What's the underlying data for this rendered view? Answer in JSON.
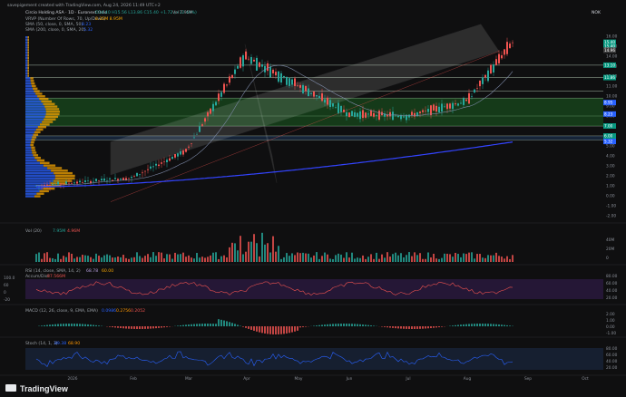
{
  "window": {
    "credit": "savepigement created with TradingView.com, Aug 24, 2026 11:49 UTC+2",
    "currency": "NOK"
  },
  "legend": {
    "symbol": "Circio Holding ASA · 1D · Euronext Oslo",
    "ohlc": "O14.40 H15.56 L13.86 C15.40 +1.72 (+12.49%)",
    "volume": "Vol 7.95M",
    "vrvp": "VRVP (Number Of Rows, 70, Up/Down)",
    "vrvp_vals": "8.35M  8.95M",
    "sma50": "SMA (50, close, 0, SMA, 50)",
    "sma50_val": "8.23",
    "sma200": "SMA (200, close, 0, SMA, 20)",
    "sma200_val": "5.32"
  },
  "price_axis": [
    {
      "label": "16.00",
      "v": 16.0
    },
    {
      "label": "15.00",
      "v": 15.0
    },
    {
      "label": "14.00",
      "v": 14.0
    },
    {
      "label": "13.00",
      "v": 13.0
    },
    {
      "label": "12.00",
      "v": 12.0
    },
    {
      "label": "11.00",
      "v": 11.0
    },
    {
      "label": "10.00",
      "v": 10.0
    },
    {
      "label": "9.00",
      "v": 9.0
    },
    {
      "label": "8.00",
      "v": 8.0
    },
    {
      "label": "7.00",
      "v": 7.0
    },
    {
      "label": "6.00",
      "v": 6.0
    },
    {
      "label": "5.00",
      "v": 5.0
    },
    {
      "label": "4.00",
      "v": 4.0
    },
    {
      "label": "3.00",
      "v": 3.0
    },
    {
      "label": "2.00",
      "v": 2.0
    },
    {
      "label": "1.00",
      "v": 1.0
    },
    {
      "label": "0.00",
      "v": 0.0
    },
    {
      "label": "-1.00",
      "v": -1.0
    },
    {
      "label": "-2.00",
      "v": -2.0
    }
  ],
  "price_tags": [
    {
      "label": "15.40",
      "v": 15.4,
      "color": "#089981"
    },
    {
      "label": "15.40",
      "v": 15.0,
      "color": "#089981"
    },
    {
      "label": "14.96",
      "v": 14.6,
      "color": "#3d3d3d"
    },
    {
      "label": "8.95",
      "v": 9.35,
      "color": "#2962ff"
    },
    {
      "label": "8.23",
      "v": 8.2,
      "color": "#2962ff"
    },
    {
      "label": "5.32",
      "v": 5.45,
      "color": "#2962ff"
    },
    {
      "label": "13.10",
      "v": 13.1,
      "color": "#089981"
    },
    {
      "label": "11.86",
      "v": 11.86,
      "color": "#089981"
    },
    {
      "label": "6.00",
      "v": 6.0,
      "color": "#089981"
    },
    {
      "label": "7.00",
      "v": 7.0,
      "color": "#089981"
    }
  ],
  "horizontal_levels": [
    13.1,
    11.86,
    10.5,
    9.8,
    8.0,
    7.0,
    6.0,
    5.6
  ],
  "time_axis": [
    "2026",
    "Feb",
    "Mar",
    "Apr",
    "May",
    "Jun",
    "Jul",
    "Aug",
    "Sep",
    "Oct"
  ],
  "panes": {
    "volume": {
      "title": "Vol (20)",
      "v1": "7.95M",
      "v2": "4.96M",
      "axis": [
        "40M",
        "20M",
        "0"
      ]
    },
    "rsi": {
      "title": "RSI (14, close, SMA, 14, 2)",
      "v1": "68.78",
      "v2": "60.00",
      "axis": [
        "80.00",
        "60.00",
        "40.00",
        "20.00"
      ],
      "sub": "Accum/Dist",
      "sub_val": "87.566M",
      "left": [
        "100.0",
        "60",
        "0",
        "-20"
      ]
    },
    "macd": {
      "title": "MACD (12, 26, close, 9, EMA, EMA)",
      "v1": "0.0986",
      "v2": "0.2756",
      "v3": "0.2052",
      "axis": [
        "2.00",
        "1.00",
        "0.00",
        "-1.00"
      ]
    },
    "stoch": {
      "title": "Stoch (14, 1, 3)",
      "v1": "89.38",
      "v2": "68.90",
      "axis": [
        "80.00",
        "60.00",
        "40.00",
        "20.00"
      ]
    }
  },
  "brand": "TradingView",
  "colors": {
    "up": "#26a69a",
    "down": "#ef5350",
    "sma50": "#2962ff",
    "channel": "#e8e8e8",
    "zone": "#1b5e20"
  },
  "chart_data": {
    "type": "candlestick",
    "x": [
      "2026",
      "Feb",
      "Mar",
      "Apr",
      "May",
      "Jun",
      "Jul",
      "Aug",
      "Sep"
    ],
    "close_estimate": [
      1.0,
      1.8,
      4.5,
      14.0,
      11.0,
      8.2,
      8.0,
      9.5,
      15.4
    ],
    "ylim": [
      -2,
      16
    ]
  }
}
